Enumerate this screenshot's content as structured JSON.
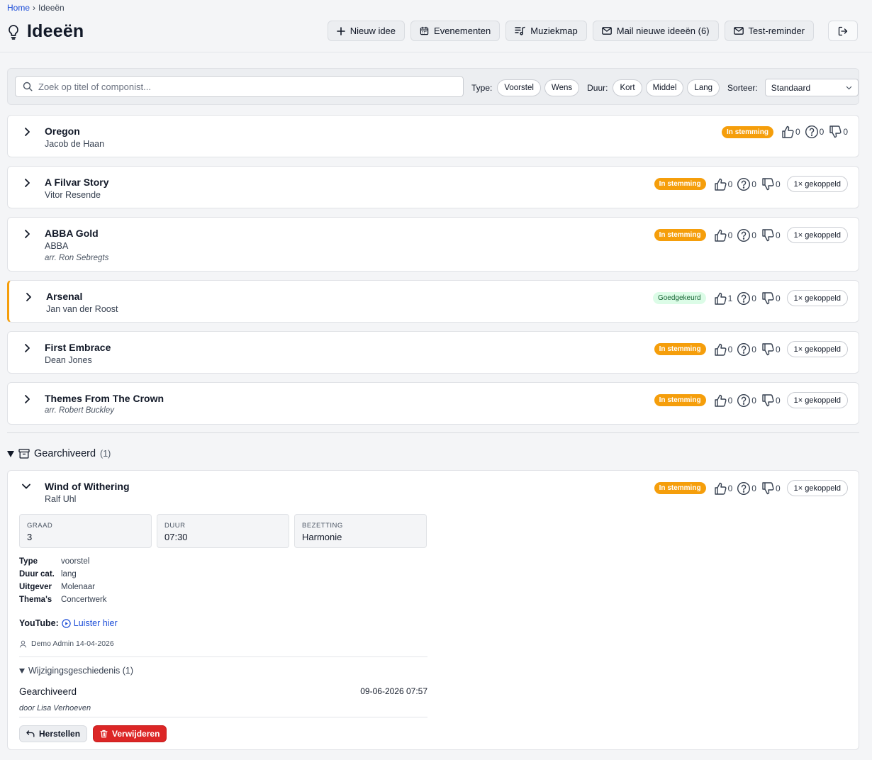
{
  "breadcrumb": {
    "home": "Home",
    "separator": "›",
    "current": "Ideeën"
  },
  "page": {
    "title": "Ideeën"
  },
  "toolbar": {
    "new_idea": "Nieuw idee",
    "events": "Evenementen",
    "music_folder": "Muziekmap",
    "mail_new": "Mail nieuwe ideeën (6)",
    "test_reminder": "Test-reminder"
  },
  "filters": {
    "search_placeholder": "Zoek op titel of componist...",
    "type_label": "Type:",
    "type_options": [
      "Voorstel",
      "Wens"
    ],
    "duration_label": "Duur:",
    "duration_options": [
      "Kort",
      "Middel",
      "Lang"
    ],
    "sort_label": "Sorteer:",
    "sort_value": "Standaard"
  },
  "ideas": [
    {
      "title": "Oregon",
      "composer": "Jacob de Haan",
      "arranger": "",
      "status": "In stemming",
      "up": "0",
      "maybe": "0",
      "down": "0",
      "linked": ""
    },
    {
      "title": "A Filvar Story",
      "composer": "Vitor Resende",
      "arranger": "",
      "status": "In stemming",
      "up": "0",
      "maybe": "0",
      "down": "0",
      "linked": "1× gekoppeld"
    },
    {
      "title": "ABBA Gold",
      "composer": "ABBA",
      "arranger": "arr. Ron Sebregts",
      "status": "In stemming",
      "up": "0",
      "maybe": "0",
      "down": "0",
      "linked": "1× gekoppeld"
    },
    {
      "title": "Arsenal",
      "composer": "Jan van der Roost",
      "arranger": "",
      "status": "Goedgekeurd",
      "up": "1",
      "maybe": "0",
      "down": "0",
      "linked": "1× gekoppeld"
    },
    {
      "title": "First Embrace",
      "composer": "Dean Jones",
      "arranger": "",
      "status": "In stemming",
      "up": "0",
      "maybe": "0",
      "down": "0",
      "linked": "1× gekoppeld"
    },
    {
      "title": "Themes From The Crown",
      "composer": "",
      "arranger": "arr. Robert Buckley",
      "status": "In stemming",
      "up": "0",
      "maybe": "0",
      "down": "0",
      "linked": "1× gekoppeld"
    }
  ],
  "archive": {
    "label": "Gearchiveerd",
    "count": "(1)",
    "item": {
      "title": "Wind of Withering",
      "composer": "Ralf Uhl",
      "status": "In stemming",
      "up": "0",
      "maybe": "0",
      "down": "0",
      "linked": "1× gekoppeld",
      "tiles": [
        {
          "label": "GRAAD",
          "value": "3"
        },
        {
          "label": "DUUR",
          "value": "07:30"
        },
        {
          "label": "BEZETTING",
          "value": "Harmonie"
        }
      ],
      "props": [
        {
          "key": "Type",
          "value": "voorstel"
        },
        {
          "key": "Duur cat.",
          "value": "lang"
        },
        {
          "key": "Uitgever",
          "value": "Molenaar"
        },
        {
          "key": "Thema's",
          "value": "Concertwerk"
        }
      ],
      "youtube_label": "YouTube:",
      "youtube_link": "Luister hier",
      "meta": "Demo Admin 14-04-2026",
      "history_label": "Wijzigingsgeschiedenis (1)",
      "history_entry": "Gearchiveerd",
      "history_time": "09-06-2026 07:57",
      "history_by": "door Lisa Verhoeven",
      "restore": "Herstellen",
      "delete": "Verwijderen"
    }
  },
  "colors": {
    "in_stemming": "#f59e0b",
    "goedgekeurd_bg": "#dcfce7",
    "goedgekeurd_text": "#166534",
    "link": "#1d4ed8",
    "delete": "#dc2626"
  }
}
